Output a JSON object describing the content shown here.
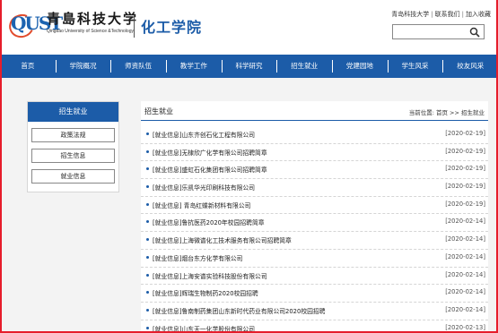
{
  "header": {
    "logo_cn": "青島科技大学",
    "logo_en": "Qingdao University of Science &Technology",
    "site_name": "化工学院",
    "links": [
      "青岛科技大学",
      "联系我们",
      "加入收藏"
    ],
    "search_placeholder": ""
  },
  "nav": [
    "首页",
    "学院概况",
    "师资队伍",
    "教学工作",
    "科学研究",
    "招生就业",
    "党建园地",
    "学生风采",
    "校友风采"
  ],
  "sidebar": {
    "title": "招生就业",
    "items": [
      "政策法规",
      "招生信息",
      "就业信息"
    ]
  },
  "content": {
    "title": "招生就业",
    "breadcrumb": "当前位置: 首页 >> 招生就业",
    "items": [
      {
        "text": "[就业信息]山东齐创石化工程有限公司",
        "date": "[2020-02-19]"
      },
      {
        "text": "[就业信息]无棣欣广化学有限公司招聘简章",
        "date": "[2020-02-19]"
      },
      {
        "text": "[就业信息]盛虹石化集团有限公司招聘简章",
        "date": "[2020-02-19]"
      },
      {
        "text": "[就业信息]乐凯华光印刷科技有限公司",
        "date": "[2020-02-19]"
      },
      {
        "text": "[就业信息] 青岛红蝶新材料有限公司",
        "date": "[2020-02-19]"
      },
      {
        "text": "[就业信息]鲁抗医药2020年校园招聘简章",
        "date": "[2020-02-14]"
      },
      {
        "text": "[就业信息]上海微谱化工技术服务有限公司招聘简章",
        "date": "[2020-02-14]"
      },
      {
        "text": "[就业信息]烟台东方化学有限公司",
        "date": "[2020-02-14]"
      },
      {
        "text": "[就业信息]上海安谱实验科技股份有限公司",
        "date": "[2020-02-14]"
      },
      {
        "text": "[就业信息]辉瑞生物制药2020校园招聘",
        "date": "[2020-02-14]"
      },
      {
        "text": "[就业信息]鲁南制药集团山东新时代药业有限公司2020校园招聘",
        "date": "[2020-02-14]"
      },
      {
        "text": "[就业信息]山东天一化学股份有限公司",
        "date": "[2020-02-13]"
      }
    ]
  },
  "colors": {
    "primary": "#1c5ca8",
    "frame": "#e61d2b",
    "bg": "#f3f3f3"
  }
}
